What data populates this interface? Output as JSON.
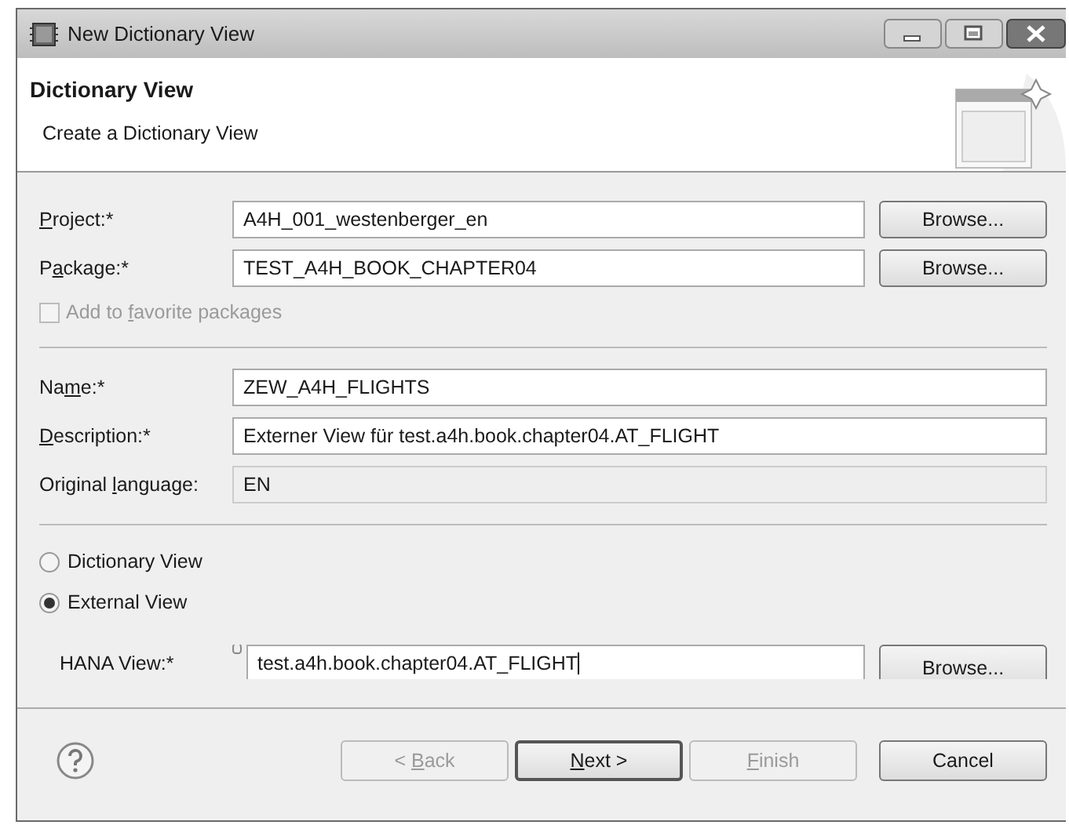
{
  "window": {
    "title": "New Dictionary View"
  },
  "header": {
    "title": "Dictionary View",
    "subtitle": "Create a Dictionary View"
  },
  "fields": [
    {
      "kind": "browse",
      "label": {
        "mnemonic": "P",
        "after": "roject:*"
      },
      "value": "A4H_001_westenberger_en",
      "button": "Browse..."
    },
    {
      "kind": "browse",
      "label": {
        "before": "P",
        "mnemonic": "a",
        "after": "ckage:*"
      },
      "value": "TEST_A4H_BOOK_CHAPTER04",
      "button": "Browse..."
    },
    {
      "kind": "checkbox",
      "label": {
        "before": "Add to ",
        "mnemonic": "f",
        "after": "avorite packages"
      },
      "checked": false,
      "disabled": true
    },
    {
      "kind": "separator"
    },
    {
      "kind": "text",
      "label": {
        "before": "Na",
        "mnemonic": "m",
        "after": "e:*"
      },
      "value": "ZEW_A4H_FLIGHTS"
    },
    {
      "kind": "text",
      "label": {
        "mnemonic": "D",
        "after": "escription:*"
      },
      "value": "Externer View für test.a4h.book.chapter04.AT_FLIGHT"
    },
    {
      "kind": "readonly",
      "label": {
        "before": "Original ",
        "mnemonic": "l",
        "after": "anguage:"
      },
      "value": "EN"
    },
    {
      "kind": "separator"
    }
  ],
  "view_types": [
    {
      "label": "Dictionary View",
      "selected": false
    },
    {
      "label": "External View",
      "selected": true
    }
  ],
  "hana_view": {
    "label": "HANA View:*",
    "value": "test.a4h.book.chapter04.AT_FLIGHT",
    "button": "Browse..."
  },
  "buttons": [
    {
      "label": {
        "before": "< ",
        "mnemonic": "B",
        "after": "ack"
      },
      "disabled": true,
      "default": false
    },
    {
      "label": {
        "mnemonic": "N",
        "after": "ext >"
      },
      "disabled": false,
      "default": true
    },
    {
      "label": {
        "mnemonic": "F",
        "after": "inish"
      },
      "disabled": true,
      "default": false
    },
    {
      "label": {
        "before": "Cancel"
      },
      "disabled": false,
      "default": false
    }
  ]
}
